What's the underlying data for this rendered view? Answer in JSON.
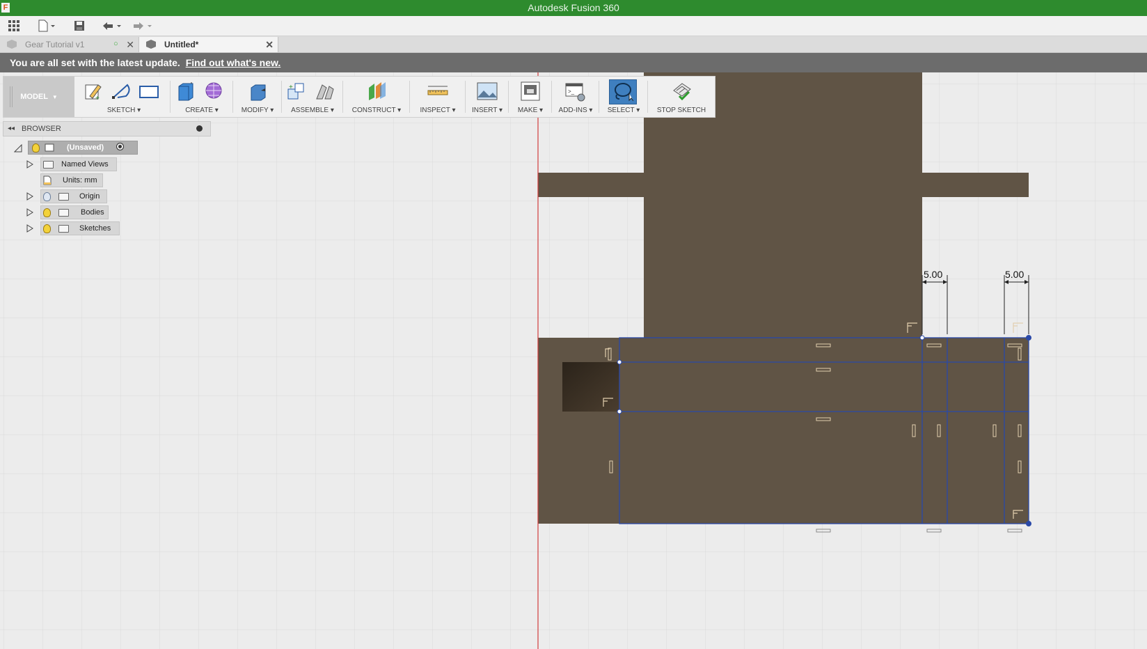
{
  "window": {
    "title": "Autodesk Fusion 360",
    "app_icon_letter": "F"
  },
  "quick_access": {
    "icons": [
      "apps-grid-icon",
      "file-menu-icon",
      "save-icon",
      "undo-icon",
      "redo-icon"
    ]
  },
  "tabs": [
    {
      "label": "Gear Tutorial v1",
      "active": false
    },
    {
      "label": "Untitled*",
      "active": true
    }
  ],
  "notification": {
    "message": "You are all set with the latest update.",
    "link": "Find out what's new."
  },
  "toolbar": {
    "workspace": "MODEL",
    "groups": [
      {
        "label": "SKETCH ▾"
      },
      {
        "label": "CREATE ▾"
      },
      {
        "label": "MODIFY ▾"
      },
      {
        "label": "ASSEMBLE ▾"
      },
      {
        "label": "CONSTRUCT ▾"
      },
      {
        "label": "INSPECT ▾"
      },
      {
        "label": "INSERT ▾"
      },
      {
        "label": "MAKE ▾"
      },
      {
        "label": "ADD-INS ▾"
      },
      {
        "label": "SELECT ▾"
      },
      {
        "label": "STOP SKETCH"
      }
    ]
  },
  "browser": {
    "title": "BROWSER",
    "root": "(Unsaved)",
    "items": [
      {
        "label": "Named Views"
      },
      {
        "label": "Units: mm"
      },
      {
        "label": "Origin"
      },
      {
        "label": "Bodies"
      },
      {
        "label": "Sketches"
      }
    ]
  },
  "sketch": {
    "dimensions": [
      "5.00",
      "5.00"
    ],
    "colors": {
      "body": "#605445",
      "sketch_line": "#2a49a8",
      "axis": "#d23c3c",
      "grid": "#d9d9d9",
      "accent": "#2e8b2e"
    }
  }
}
